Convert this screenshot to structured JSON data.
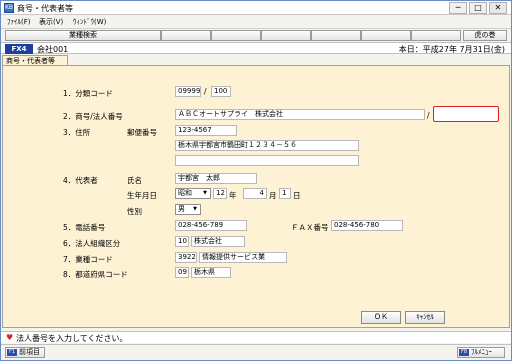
{
  "window": {
    "title": "商号・代表者等",
    "minimize": "─",
    "maximize": "□",
    "close": "✕"
  },
  "menu": [
    "ﾌｧｲﾙ(F)",
    "表示(V)",
    "ｳｨﾝﾄﾞｳ(W)"
  ],
  "toolbar": {
    "search_label": "業種検索",
    "help_label": "虎の巻"
  },
  "info": {
    "badge": "FX4",
    "company": "会社001",
    "today": "本日：平成27年 7月31日(金)"
  },
  "tab": "商号・代表者等",
  "form": {
    "classification": {
      "label": "1．分類コード",
      "value1": "09999",
      "sep": "/",
      "value2": "100"
    },
    "trade_name": {
      "label": "2．商号/法人番号",
      "value": "ＡＢＣオートサプライ　株式会社",
      "sep": "/",
      "corp_number": ""
    },
    "address": {
      "label": "3．住所",
      "postal_label": "郵便番号",
      "postal": "123-4567",
      "line1": "栃木県宇都宮市鶴田町１２３４－５６",
      "line2": ""
    },
    "representative": {
      "label": "4．代表者",
      "name_label": "氏名",
      "name": "宇都宮　太郎",
      "birth_label": "生年月日",
      "era": "昭和",
      "year": "12",
      "year_unit": "年",
      "month": "4",
      "month_unit": "月",
      "day": "1",
      "day_unit": "日",
      "gender_label": "性別",
      "gender": "男"
    },
    "phone": {
      "label": "5．電話番号",
      "value": "028-456-789",
      "fax_label": "ＦＡＸ番号",
      "fax": "028-456-780"
    },
    "org_type": {
      "label": "6．法人組織区分",
      "code": "10",
      "name": "株式会社"
    },
    "industry": {
      "label": "7．業種コード",
      "code": "3922",
      "name": "情報提供サービス業"
    },
    "prefecture": {
      "label": "8．都道府県コード",
      "code": "09",
      "name": "栃木県"
    }
  },
  "buttons": {
    "ok": "ＯＫ",
    "cancel": "ｷｬﾝｾﾙ"
  },
  "status": {
    "message": "法人番号を入力してください。"
  },
  "fkeys": {
    "f1_key": "F1",
    "f1_label": "前項目",
    "f8_key": "F8",
    "f8_label": "ﾌﾙﾒﾆｭｰ"
  }
}
